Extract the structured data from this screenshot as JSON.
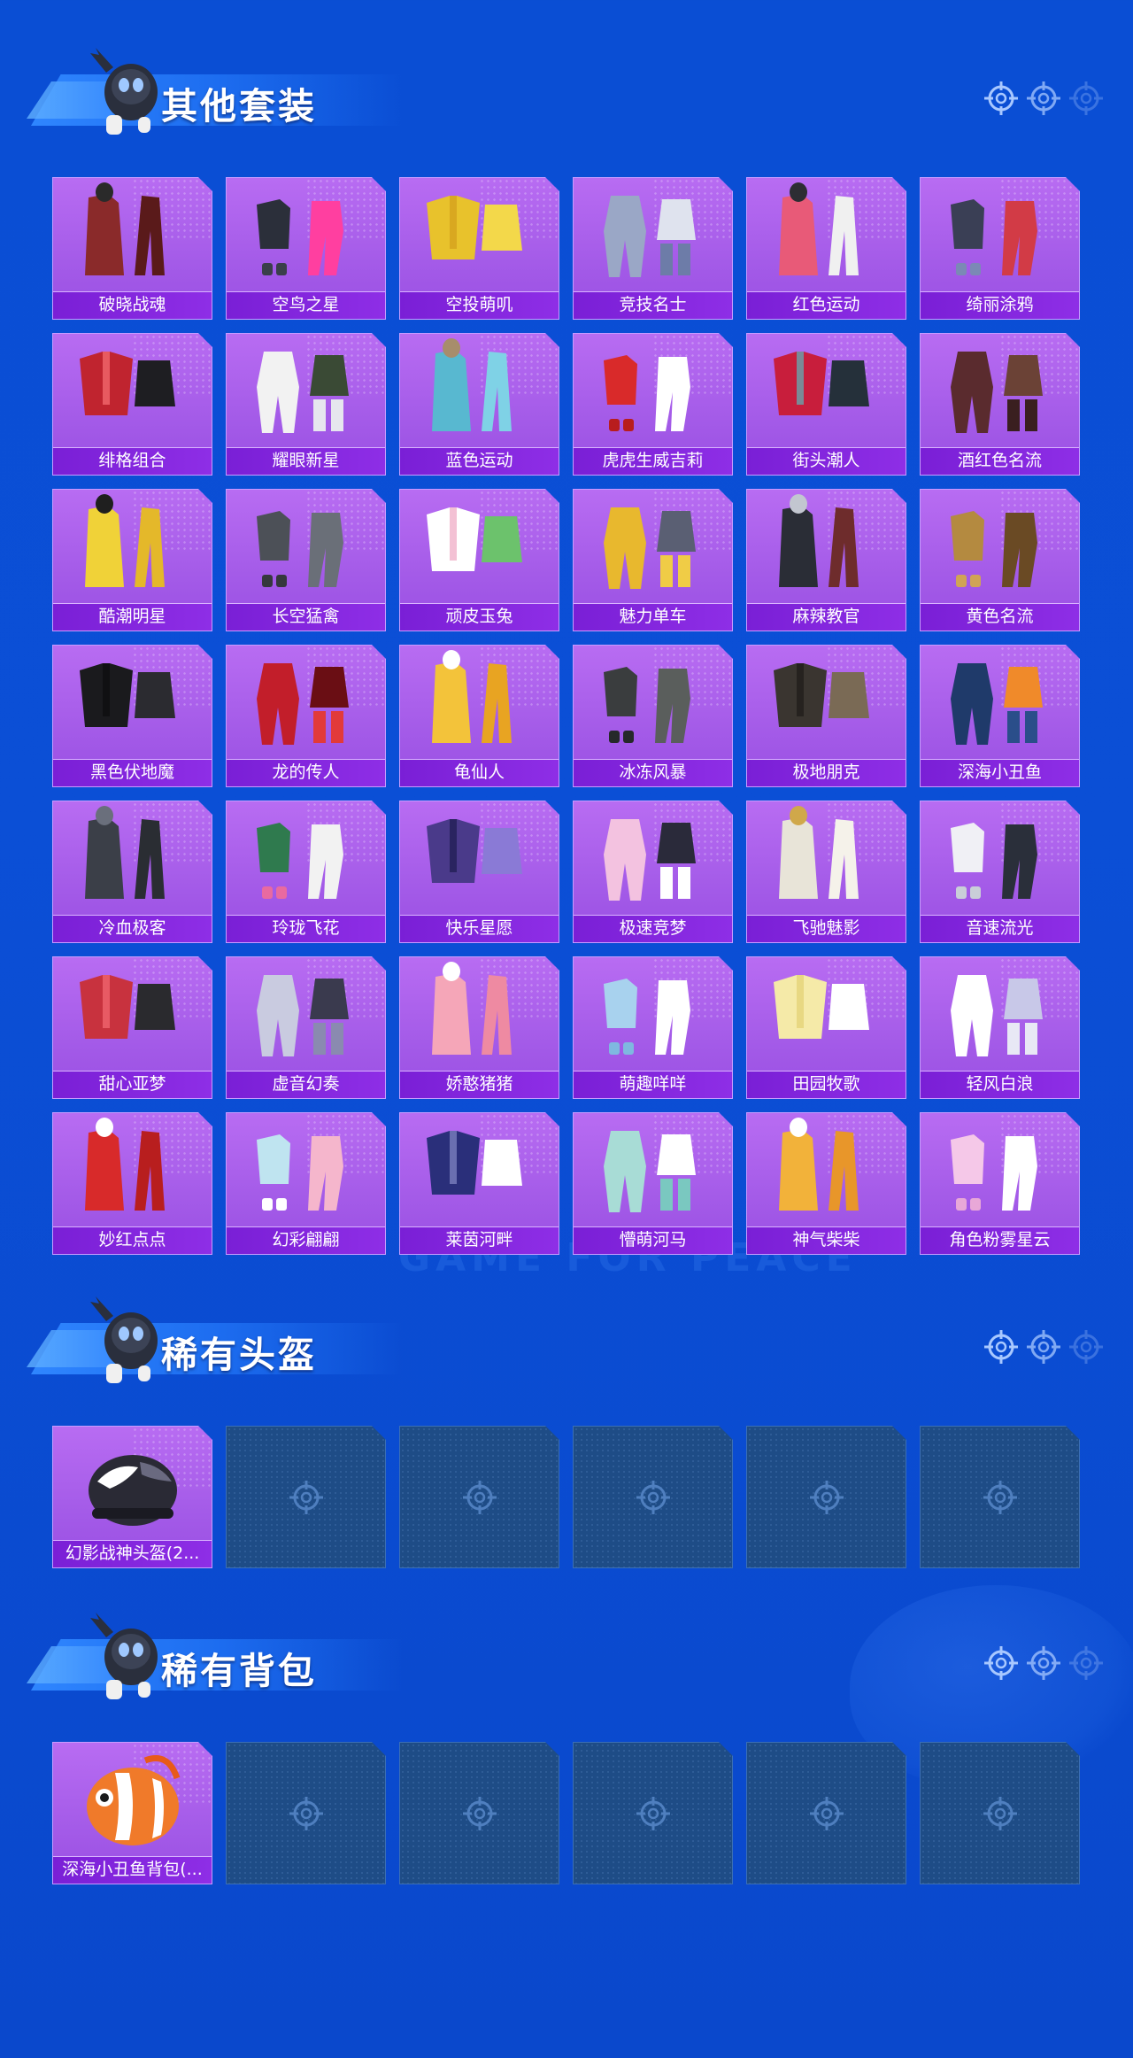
{
  "watermark": "GAME FOR PEACE",
  "sections": [
    {
      "title": "其他套装",
      "items": [
        {
          "label": "破晓战魂",
          "palette": [
            "#8a2a2a",
            "#2a2a2a",
            "#5a1a1a"
          ]
        },
        {
          "label": "空鸟之星",
          "palette": [
            "#2b2f3a",
            "#ff3fa0",
            "#3a3f4a"
          ]
        },
        {
          "label": "空投萌叽",
          "palette": [
            "#e8c22c",
            "#f3d84a",
            "#d9a820"
          ]
        },
        {
          "label": "竞技名士",
          "palette": [
            "#9aa7c6",
            "#dfe3ee",
            "#6d7ca8"
          ]
        },
        {
          "label": "红色运动",
          "palette": [
            "#e85a78",
            "#2d2d33",
            "#f0f0f0"
          ]
        },
        {
          "label": "绮丽涂鸦",
          "palette": [
            "#3a3f55",
            "#d23b46",
            "#7b89b5"
          ]
        },
        {
          "label": "绯格组合",
          "palette": [
            "#c0242f",
            "#1e1e22",
            "#e85a60"
          ]
        },
        {
          "label": "耀眼新星",
          "palette": [
            "#f2f2f2",
            "#3a4a35",
            "#e6e6ee"
          ]
        },
        {
          "label": "蓝色运动",
          "palette": [
            "#58b8d0",
            "#a78d6c",
            "#7fd2e6"
          ]
        },
        {
          "label": "虎虎生威吉莉",
          "palette": [
            "#d92a2a",
            "#ffffff",
            "#b81d1d"
          ]
        },
        {
          "label": "街头潮人",
          "palette": [
            "#c81e3c",
            "#25303a",
            "#7a8a96"
          ]
        },
        {
          "label": "酒红色名流",
          "palette": [
            "#5a2b2e",
            "#6b4236",
            "#3a1f20"
          ]
        },
        {
          "label": "酷潮明星",
          "palette": [
            "#f0d238",
            "#1f1f1f",
            "#e4b82a"
          ]
        },
        {
          "label": "长空猛禽",
          "palette": [
            "#4c5057",
            "#6a6f78",
            "#35383d"
          ]
        },
        {
          "label": "顽皮玉兔",
          "palette": [
            "#ffffff",
            "#6cc26c",
            "#f3c1d4"
          ]
        },
        {
          "label": "魅力单车",
          "palette": [
            "#e8b82e",
            "#5a5f73",
            "#f0cc46"
          ]
        },
        {
          "label": "麻辣教官",
          "palette": [
            "#2a2d36",
            "#c2c6d0",
            "#6e2c2c"
          ]
        },
        {
          "label": "黄色名流",
          "palette": [
            "#b48a40",
            "#6a4a24",
            "#d0a455"
          ]
        },
        {
          "label": "黑色伏地魔",
          "palette": [
            "#1a1a1d",
            "#2b2b30",
            "#101012"
          ]
        },
        {
          "label": "龙的传人",
          "palette": [
            "#c21e2a",
            "#6a0e14",
            "#e23a3a"
          ]
        },
        {
          "label": "龟仙人",
          "palette": [
            "#f3c33a",
            "#ffffff",
            "#e8a422"
          ]
        },
        {
          "label": "冰冻风暴",
          "palette": [
            "#3a3d3e",
            "#5a5e5c",
            "#26292a"
          ]
        },
        {
          "label": "极地朋克",
          "palette": [
            "#3a3530",
            "#7a6a55",
            "#26221f"
          ]
        },
        {
          "label": "深海小丑鱼",
          "palette": [
            "#1f3a6a",
            "#f08a2a",
            "#2a4e8a"
          ]
        },
        {
          "label": "冷血极客",
          "palette": [
            "#3b3f48",
            "#6a6f7c",
            "#2a2d33"
          ]
        },
        {
          "label": "玲珑飞花",
          "palette": [
            "#2f7a4e",
            "#f2f2f2",
            "#e86aa0"
          ]
        },
        {
          "label": "快乐星愿",
          "palette": [
            "#4a3a8a",
            "#8a7ad6",
            "#2a2460"
          ]
        },
        {
          "label": "极速竞梦",
          "palette": [
            "#f3c2e0",
            "#2a2a3a",
            "#ffffff"
          ]
        },
        {
          "label": "飞驰魅影",
          "palette": [
            "#e8e4d8",
            "#d0a84a",
            "#f5f2ea"
          ]
        },
        {
          "label": "音速流光",
          "palette": [
            "#f0f0f5",
            "#2a2f3a",
            "#c9ced8"
          ]
        },
        {
          "label": "甜心亚梦",
          "palette": [
            "#c8323e",
            "#2a2a2e",
            "#e85a64"
          ]
        },
        {
          "label": "虚音幻奏",
          "palette": [
            "#c9cbe0",
            "#3a3a4e",
            "#8a8ab0"
          ]
        },
        {
          "label": "娇憨猪猪",
          "palette": [
            "#f5a6b8",
            "#ffffff",
            "#ee8aa2"
          ]
        },
        {
          "label": "萌趣咩咩",
          "palette": [
            "#a8d2ee",
            "#ffffff",
            "#7fb8e0"
          ]
        },
        {
          "label": "田园牧歌",
          "palette": [
            "#f5eaa8",
            "#ffffff",
            "#e8d882"
          ]
        },
        {
          "label": "轻风白浪",
          "palette": [
            "#ffffff",
            "#c8c8e8",
            "#e8e8f5"
          ]
        },
        {
          "label": "妙红点点",
          "palette": [
            "#d82a2a",
            "#ffffff",
            "#b81e1e"
          ]
        },
        {
          "label": "幻彩翩翩",
          "palette": [
            "#bfe4f0",
            "#f5b6cc",
            "#ffffff"
          ]
        },
        {
          "label": "莱茵河畔",
          "palette": [
            "#2a2f7a",
            "#ffffff",
            "#6a6fb0"
          ]
        },
        {
          "label": "懵萌河马",
          "palette": [
            "#a8dcd6",
            "#ffffff",
            "#7ac8c0"
          ]
        },
        {
          "label": "神气柴柴",
          "palette": [
            "#f2b23a",
            "#ffffff",
            "#e8962a"
          ]
        },
        {
          "label": "角色粉雾星云",
          "palette": [
            "#f5c8e8",
            "#ffffff",
            "#e8a8d8"
          ]
        }
      ]
    },
    {
      "title": "稀有头盔",
      "items": [
        {
          "label": "幻影战神头盔(2...",
          "palette": [
            "#2a2a35",
            "#ffffff",
            "#6a6a80"
          ]
        }
      ],
      "empty_slots": 5
    },
    {
      "title": "稀有背包",
      "items": [
        {
          "label": "深海小丑鱼背包(...",
          "palette": [
            "#f07a2a",
            "#ffffff",
            "#e85a1a"
          ]
        }
      ],
      "empty_slots": 5
    }
  ],
  "colors": {
    "background": "#0b4fd6",
    "card_purple": "#a45be8",
    "label_bar": "#7a1fd6",
    "empty_slot": "#1e4c86"
  },
  "icons": [
    "crosshair-icon",
    "mascot-icon"
  ]
}
